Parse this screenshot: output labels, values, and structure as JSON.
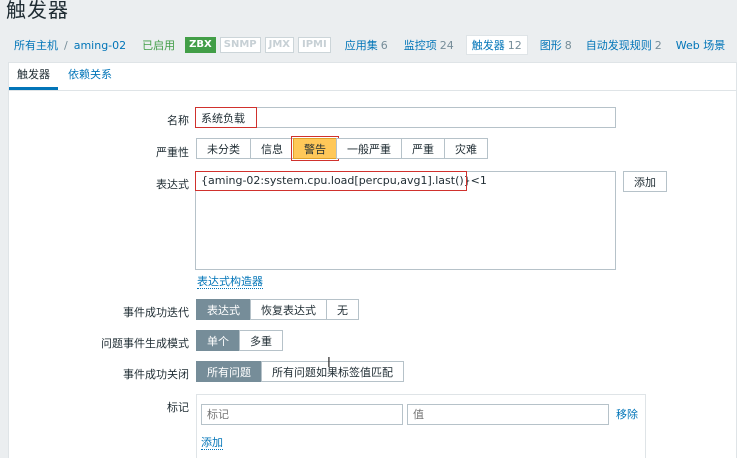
{
  "page": {
    "title": "触发器"
  },
  "hostnav": {
    "all_hosts": "所有主机",
    "separator": "/",
    "host": "aming-02",
    "status": "已启用",
    "tags": [
      "ZBX",
      "SNMP",
      "JMX",
      "IPMI"
    ],
    "links": [
      {
        "label": "应用集",
        "count": "6"
      },
      {
        "label": "监控项",
        "count": "24"
      },
      {
        "label": "触发器",
        "count": "12"
      },
      {
        "label": "图形",
        "count": "8"
      },
      {
        "label": "自动发现规则",
        "count": "2"
      },
      {
        "label": "Web 场景",
        "count": ""
      }
    ]
  },
  "tabs": [
    "触发器",
    "依赖关系"
  ],
  "form": {
    "name_label": "名称",
    "name_value": "系统负载",
    "severity_label": "严重性",
    "severity_options": [
      "未分类",
      "信息",
      "警告",
      "一般严重",
      "严重",
      "灾难"
    ],
    "severity_selected": "警告",
    "expression_label": "表达式",
    "expression_value": "{aming-02:system.cpu.load[percpu,avg1].last()}<1",
    "add_button": "添加",
    "expression_builder": "表达式构造器",
    "ok_event_label": "事件成功迭代",
    "ok_event_options": [
      "表达式",
      "恢复表达式",
      "无"
    ],
    "ok_event_selected": "表达式",
    "problem_mode_label": "问题事件生成模式",
    "problem_mode_options": [
      "单个",
      "多重"
    ],
    "problem_mode_selected": "单个",
    "ok_close_label": "事件成功关闭",
    "ok_close_options": [
      "所有问题",
      "所有问题如果标签值匹配"
    ],
    "ok_close_selected": "所有问题",
    "tags_label": "标记",
    "tag_placeholder": "标记",
    "value_placeholder": "值",
    "remove_link": "移除",
    "add_link": "添加"
  },
  "colors": {
    "accent": "#0275b8",
    "enabled": "#429e47",
    "warning": "#ffc859",
    "selected": "#768d99",
    "highlight": "#d0312d"
  }
}
